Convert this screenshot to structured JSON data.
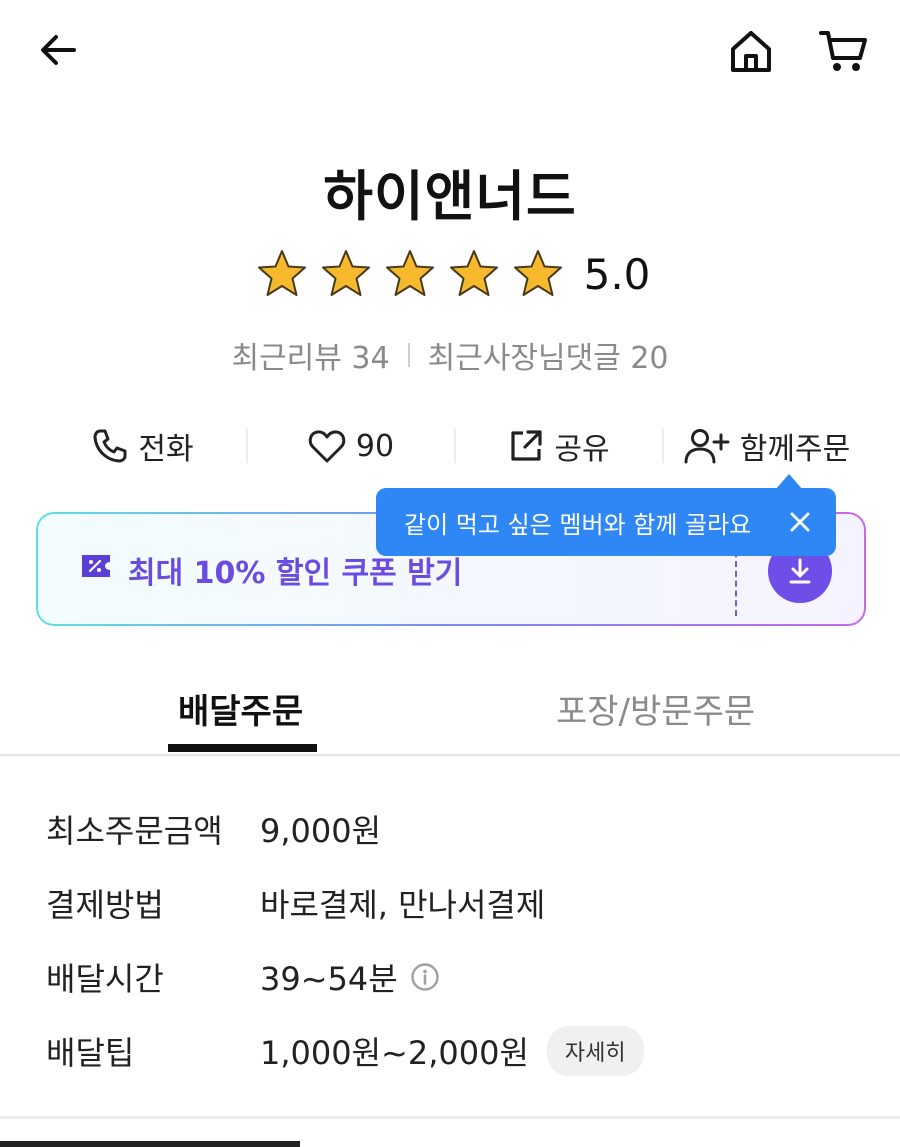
{
  "header": {
    "back_icon": "back-arrow-icon",
    "home_icon": "home-icon",
    "cart_icon": "cart-icon"
  },
  "store": {
    "name": "하이앤너드",
    "rating": "5.0",
    "stars": 5,
    "recent_reviews": "최근리뷰 34",
    "recent_owner_comments": "최근사장님댓글 20"
  },
  "actions": [
    {
      "label": "전화",
      "icon": "phone-icon"
    },
    {
      "label": "90",
      "icon": "heart-icon"
    },
    {
      "label": "공유",
      "icon": "share-icon"
    },
    {
      "label": "함께주문",
      "icon": "add-user-icon"
    }
  ],
  "coupon": {
    "label": "최대 10% 할인 쿠폰 받기",
    "icon": "coupon-icon",
    "download_icon": "download-icon"
  },
  "tooltip": {
    "text": "같이 먹고 싶은 멤버와 함께 골라요",
    "color": "#2f86f5"
  },
  "tabs": [
    {
      "label": "배달주문",
      "active": true
    },
    {
      "label": "포장/방문주문",
      "active": false
    }
  ],
  "info": {
    "min_order": {
      "label": "최소주문금액",
      "value": "9,000원"
    },
    "payment": {
      "label": "결제방법",
      "value": "바로결제, 만나서결제"
    },
    "delivery_time": {
      "label": "배달시간",
      "value": "39~54분"
    },
    "delivery_tip": {
      "label": "배달팁",
      "value": "1,000원~2,000원",
      "detail": "자세히"
    }
  },
  "colors": {
    "accent": "#6f4de8",
    "star": "#f5b82e"
  }
}
